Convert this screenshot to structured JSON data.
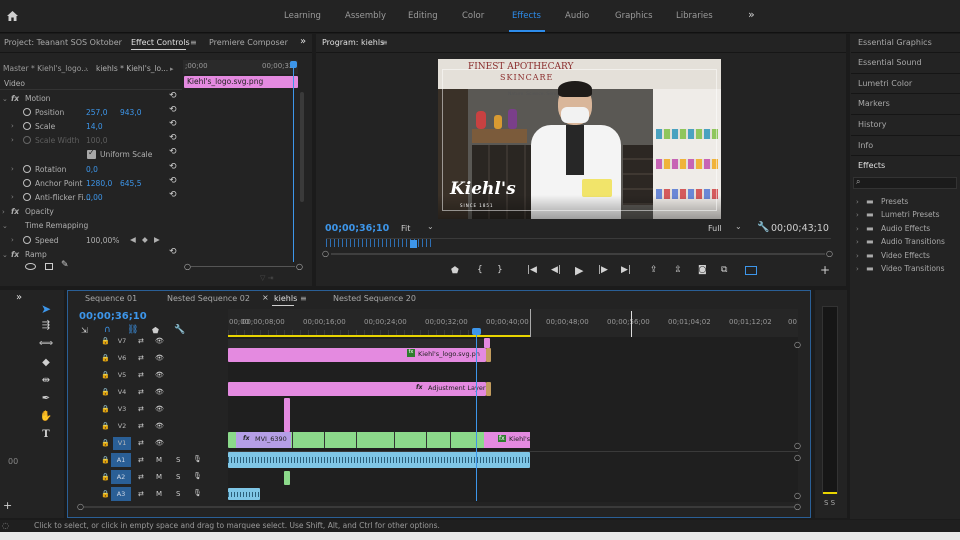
{
  "workspaces": [
    "Learning",
    "Assembly",
    "Editing",
    "Color",
    "Effects",
    "Audio",
    "Graphics",
    "Libraries"
  ],
  "active_workspace": "Effects",
  "overflow_glyph": "»",
  "effect_controls": {
    "project_tab": "Project: Teanant SOS Oktober",
    "tab": "Effect Controls",
    "tab_menu": "≡",
    "other_tab": "Premiere Composer",
    "master": "Master * Kiehl's_logo...",
    "clip": "kiehls * Kiehl's_lo...",
    "mini_time": ";00;00",
    "mini_time2": "00;00;32",
    "clip_label": "Kiehl's_logo.svg.png",
    "section": "Video",
    "motion": "Motion",
    "position_label": "Position",
    "position_x": "257,0",
    "position_y": "943,0",
    "scale_label": "Scale",
    "scale_value": "14,0",
    "scale_width_label": "Scale Width",
    "scale_width_value": "100,0",
    "uniform_scale": "Uniform Scale",
    "rotation_label": "Rotation",
    "rotation_value": "0,0",
    "anchor_label": "Anchor Point",
    "anchor_x": "1280,0",
    "anchor_y": "645,5",
    "flicker_label": "Anti-flicker Fi...",
    "flicker_value": "0,00",
    "opacity": "Opacity",
    "time_remap": "Time Remapping",
    "speed_label": "Speed",
    "speed_value": "100,00%",
    "ramp": "Ramp",
    "timecode": "00;00;36;10"
  },
  "program": {
    "title": "Program: kiehls",
    "title_menu": "≡",
    "timecode": "00;00;36;10",
    "fit": "Fit",
    "quality": "Full",
    "duration": "00;00;43;10",
    "video_text": {
      "sign_top": "FINEST APOTHECARY",
      "sign_mid": "SKINCARE",
      "sign_sub": "Nature. Science. Service.",
      "logo": "Kiehl's",
      "logo_sub": "SINCE 1851"
    }
  },
  "timeline": {
    "tabs": [
      "Sequence 01",
      "Nested Sequence 02",
      "kiehls",
      "Nested Sequence 20"
    ],
    "active_tab": "kiehls",
    "timecode": "00;00;36;10",
    "ruler": [
      "00;00",
      "00;00;08;00",
      "00;00;16;00",
      "00;00;24;00",
      "00;00;32;00",
      "00;00;40;00",
      "00;00;48;00",
      "00;00;56;00",
      "00;01;04;02",
      "00;01;12;02",
      "00"
    ],
    "video_tracks": [
      "V7",
      "V6",
      "V5",
      "V4",
      "V3",
      "V2",
      "V1"
    ],
    "audio_tracks": [
      "A1",
      "A2",
      "A3"
    ],
    "audio_flags": [
      "M",
      "S"
    ],
    "clips": {
      "logo": "Kiehl's_logo.svg.pn",
      "adjustment": "Adjustment Layer",
      "mvi": "MVI_6390",
      "kiehls": "Kiehl's",
      "fx": "fx"
    },
    "meter_labels": "S S",
    "meter_db": "0"
  },
  "right_panel": {
    "items": [
      "Essential Graphics",
      "Essential Sound",
      "Lumetri Color",
      "Markers",
      "History",
      "Info",
      "Effects"
    ],
    "folders": [
      "Presets",
      "Lumetri Presets",
      "Audio Effects",
      "Audio Transitions",
      "Video Effects",
      "Video Transitions"
    ]
  },
  "status_bar": "Click to select, or click in empty space and drag to marquee select. Use Shift, Alt, and Ctrl for other options.",
  "tools_left_label": "00",
  "colors": {
    "accent": "#2d8ceb",
    "pink_clip": "#e48ae0",
    "green_clip": "#8bd98a",
    "audio_clip": "#7fc6e6",
    "playhead": "#3d96ea"
  }
}
